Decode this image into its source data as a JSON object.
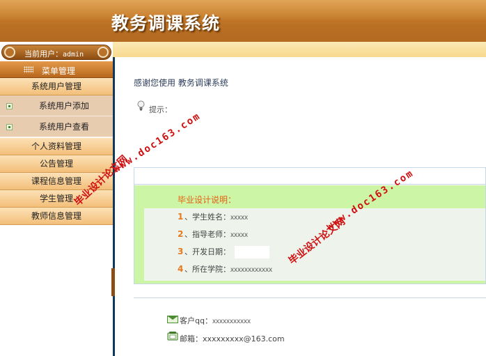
{
  "header": {
    "title": "教务调课系统"
  },
  "sidebar": {
    "current_user_label": "当前用户：",
    "current_user_name": "admin",
    "menu_header": "菜单管理",
    "items": [
      {
        "label": "系统用户管理"
      },
      {
        "label": "系统用户添加"
      },
      {
        "label": "系统用户查看"
      },
      {
        "label": "个人资料管理"
      },
      {
        "label": "公告管理"
      },
      {
        "label": "课程信息管理"
      },
      {
        "label": "学生管理"
      },
      {
        "label": "教师信息管理"
      }
    ]
  },
  "main": {
    "thanks": "感谢您使用 教务调课系统",
    "tip": "提示：",
    "info": {
      "title": "毕业设计说明：",
      "rows": [
        {
          "num": "1",
          "label": "、学生姓名：",
          "value": "xxxxx"
        },
        {
          "num": "2",
          "label": "、指导老师：",
          "value": "xxxxx"
        },
        {
          "num": "3",
          "label": "、开发日期：",
          "value": ""
        },
        {
          "num": "4",
          "label": "、所在学院：",
          "value": "xxxxxxxxxxxx"
        }
      ]
    },
    "contact": {
      "qq_label": "客户qq：",
      "qq_value": "xxxxxxxxxxx",
      "mail_label": "邮箱：",
      "mail_value": "xxxxxxxxx@163.com"
    }
  },
  "watermarks": [
    {
      "text": "毕业设计论文网"
    },
    {
      "text": "www.doc163.com"
    },
    {
      "text": "毕业设计论文网"
    },
    {
      "text": "www.doc163.com"
    }
  ],
  "colors": {
    "header_brown": "#b6691f",
    "nav_orange": "#f3bf7a",
    "info_green": "#ccf5a6",
    "info_title_orange": "#e65e10",
    "divider_navy": "#10385c",
    "watermark_red": "#d01010"
  }
}
